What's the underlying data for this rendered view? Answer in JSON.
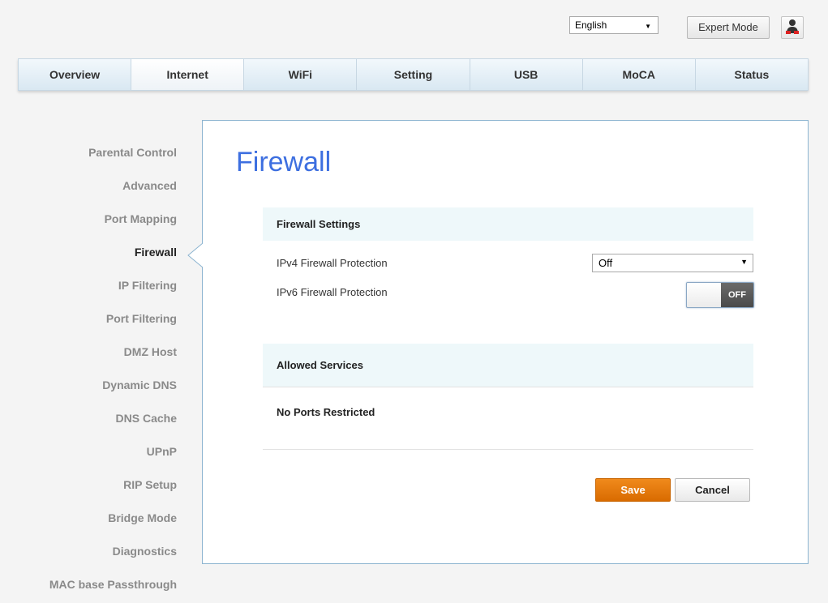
{
  "header": {
    "language": "English",
    "expert_mode_label": "Expert Mode",
    "user_icon": "user-icon"
  },
  "nav": {
    "tabs": [
      {
        "label": "Overview"
      },
      {
        "label": "Internet"
      },
      {
        "label": "WiFi"
      },
      {
        "label": "Setting"
      },
      {
        "label": "USB"
      },
      {
        "label": "MoCA"
      },
      {
        "label": "Status"
      }
    ],
    "active": "Internet"
  },
  "sidebar": {
    "items": [
      {
        "label": "Parental Control"
      },
      {
        "label": "Advanced"
      },
      {
        "label": "Port Mapping"
      },
      {
        "label": "Firewall"
      },
      {
        "label": "IP Filtering"
      },
      {
        "label": "Port Filtering"
      },
      {
        "label": "DMZ Host"
      },
      {
        "label": "Dynamic DNS"
      },
      {
        "label": "DNS Cache"
      },
      {
        "label": "UPnP"
      },
      {
        "label": "RIP Setup"
      },
      {
        "label": "Bridge Mode"
      },
      {
        "label": "Diagnostics"
      },
      {
        "label": "MAC base Passthrough"
      }
    ],
    "active": "Firewall"
  },
  "main": {
    "title": "Firewall",
    "firewall_settings": {
      "heading": "Firewall Settings",
      "ipv4_label": "IPv4 Firewall Protection",
      "ipv4_value": "Off",
      "ipv6_label": "IPv6 Firewall Protection",
      "ipv6_toggle": "OFF"
    },
    "allowed_services": {
      "heading": "Allowed Services",
      "status": "No Ports Restricted"
    },
    "save_label": "Save",
    "cancel_label": "Cancel"
  },
  "colors": {
    "title": "#3d6fe0",
    "save": "#e27a0f",
    "section_bg": "#eef8fa"
  }
}
